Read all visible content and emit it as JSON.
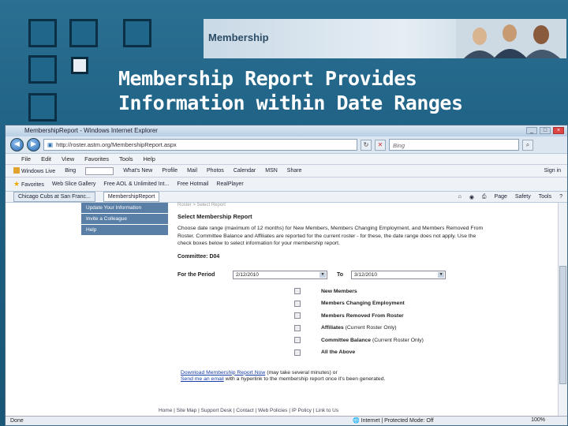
{
  "slide": {
    "heading_line1": "Membership Report Provides",
    "heading_line2": "Information within Date Ranges",
    "banner_title": "Membership"
  },
  "browser": {
    "window_title": "MembershipReport - Windows Internet Explorer",
    "address": "http://roster.astm.org/MembershipReport.aspx",
    "search_placeholder": "Bing",
    "menu": [
      "File",
      "Edit",
      "View",
      "Favorites",
      "Tools",
      "Help"
    ],
    "toolbar": [
      "Windows Live",
      "Bing",
      "What's New",
      "Profile",
      "Mail",
      "Photos",
      "Calendar",
      "MSN",
      "Share",
      "Sign in"
    ],
    "favorites_label": "Favorites",
    "fav_links": [
      "Web Slice Gallery",
      "Free AOL & Unlimited Int...",
      "Free Hotmail",
      "RealPlayer"
    ],
    "tabs": [
      "Chicago Cubs at San Franc...",
      "MembershipReport"
    ],
    "command_right": [
      "Page",
      "Safety",
      "Tools"
    ],
    "status_left": "Done",
    "status_zone": "Internet | Protected Mode: Off",
    "status_zoom": "100%"
  },
  "page": {
    "sidebar": [
      "Update Your Information",
      "Invite a Colleague",
      "Help"
    ],
    "breadcrumb": "Roster > Select Report",
    "select_title": "Select Membership Report",
    "description": "Choose date range (maximum of 12 months) for New Members, Members Changing Employment, and Members Removed From Roster. Committee Balance and Affiliates are reported for the current roster - for these, the date range does not apply. Use the check boxes below to select information for your membership report.",
    "committee": "Committee: D04",
    "period_label": "For the Period",
    "from_date": "2/12/2010",
    "to_label": "To",
    "to_date": "3/12/2010",
    "options": [
      {
        "label": "New Members",
        "note": ""
      },
      {
        "label": "Members Changing Employment",
        "note": ""
      },
      {
        "label": "Members Removed From Roster",
        "note": ""
      },
      {
        "label": "Affiliates",
        "note": "(Current Roster Only)"
      },
      {
        "label": "Committee Balance",
        "note": "(Current Roster Only)"
      },
      {
        "label": "All the Above",
        "note": ""
      }
    ],
    "download_link": "Download Membership Report Now",
    "download_note": "(may take several minutes) or",
    "email_link": "Send me an email",
    "email_note": "with a hyperlink to the membership report once it's been generated.",
    "footer_links": "Home | Site Map | Support Desk | Contact | Web Policies | IP Policy | Link to Us"
  }
}
